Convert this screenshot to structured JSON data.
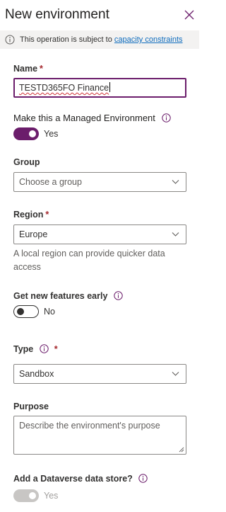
{
  "panel": {
    "title": "New environment"
  },
  "banner": {
    "text": "This operation is subject to",
    "link": "capacity constraints"
  },
  "fields": {
    "name": {
      "label": "Name",
      "required": "*",
      "value": "TESTD365FO Finance"
    },
    "managed": {
      "label": "Make this a Managed Environment",
      "state": "Yes",
      "on": true
    },
    "group": {
      "label": "Group",
      "placeholder": "Choose a group"
    },
    "region": {
      "label": "Region",
      "required": "*",
      "value": "Europe",
      "hint": "A local region can provide quicker data access"
    },
    "early_features": {
      "label": "Get new features early",
      "state": "No",
      "on": false
    },
    "type": {
      "label": "Type",
      "required": "*",
      "value": "Sandbox"
    },
    "purpose": {
      "label": "Purpose",
      "placeholder": "Describe the environment's purpose"
    },
    "dataverse": {
      "label": "Add a Dataverse data store?",
      "state": "Yes",
      "on": true,
      "disabled": true
    }
  },
  "colors": {
    "accent": "#6b1d6b",
    "link": "#0f6cbd",
    "required": "#a4262c"
  },
  "icons": {
    "close": "close-icon",
    "info": "info-icon",
    "chevron": "chevron-down-icon"
  }
}
